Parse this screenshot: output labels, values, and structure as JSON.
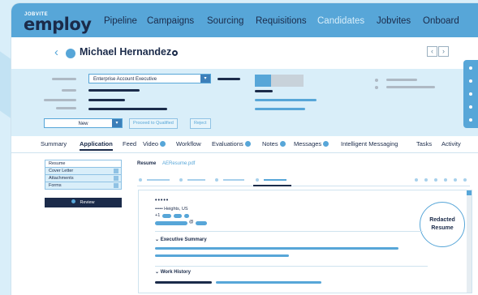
{
  "brand": {
    "small": "JOBVITE",
    "big": "employ"
  },
  "nav": [
    "Pipeline",
    "Campaigns",
    "Sourcing",
    "Requisitions",
    "Candidates",
    "Jobvites",
    "Onboard"
  ],
  "candidate": {
    "name": "Michael Hernandez"
  },
  "pager": {
    "prev": "‹",
    "next": "›"
  },
  "job_select": {
    "value": "Enterprise Account Executive",
    "arrow": "▾"
  },
  "status_select": {
    "value": "New",
    "arrow": "▾"
  },
  "actions": {
    "proceed": "Proceed to Qualified",
    "reject": "Reject"
  },
  "tabs": [
    "Summary",
    "Application",
    "Feed",
    "Video",
    "Workflow",
    "Evaluations",
    "Notes",
    "Messages",
    "Intelligent Messaging",
    "Tasks",
    "Activity"
  ],
  "left_menu": [
    "Resume",
    "Cover Letter",
    "Attachments",
    "Forms"
  ],
  "review_label": "Review",
  "resume_tabs": {
    "label": "Resume",
    "file": "AEResume.pdf"
  },
  "resume": {
    "masked_name": "•••••",
    "location": "••••• Heights, US",
    "phone_prefix": "+1",
    "email_at": "@",
    "redacted": "Redacted Resume",
    "sections": {
      "summary": "Executive Summary",
      "history": "Work History"
    }
  }
}
